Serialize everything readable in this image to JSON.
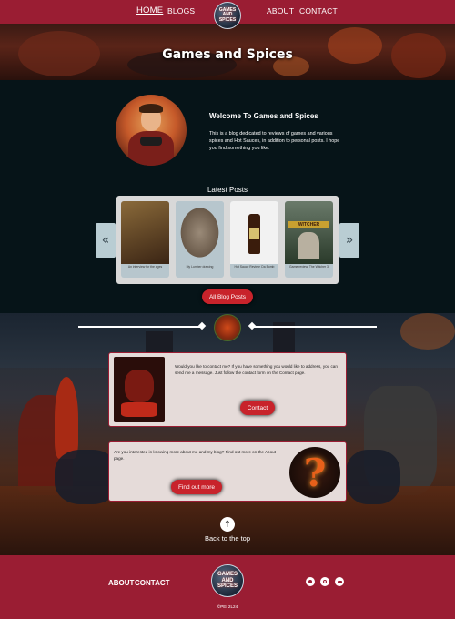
{
  "nav": {
    "home": "HOME",
    "blogs": "BLOGS",
    "about": "ABOUT",
    "contact": "CONTACT",
    "logo_text": "GAMES AND SPICES"
  },
  "hero": {
    "title": "Games and Spices"
  },
  "welcome": {
    "title": "Welcome To Games and Spices",
    "text": "This is a blog dedicated to reviews of games and various spices and Hot Sauces, in addition to personal posts. I hope you find something you like."
  },
  "latest": {
    "title": "Latest Posts",
    "prev_icon": "chevron-left-icon",
    "next_icon": "chevron-right-icon",
    "posts": [
      {
        "caption": "An interview for the ages",
        "color": "#6b4a2a"
      },
      {
        "caption": "My Lumber drawing",
        "color": "#8a7a6a"
      },
      {
        "caption": "Hot Sauce Review: Da Bomb",
        "color": "#f0f0f0"
      },
      {
        "caption": "Game review: The Witcher 3",
        "color": "#4a5a3a"
      }
    ],
    "button": "All Blog Posts"
  },
  "contact_box": {
    "text": "Would you like to contact me? If you have something you would like to address, you can send me a message. Just follow the contact form on the Contact page.",
    "button": "Contact"
  },
  "about_box": {
    "text": "Are you interested in knowing more about me and my blog? Find out more on the About page.",
    "button": "Find out more"
  },
  "back_to_top": "Back to the top",
  "footer": {
    "about": "ABOUT",
    "contact": "CONTACT",
    "logo_text": "GAMES AND SPICES",
    "social": [
      "facebook-icon",
      "instagram-icon",
      "youtube-icon"
    ],
    "copyright": "©PEI 2L24"
  },
  "colors": {
    "brand": "#9a1d33",
    "button": "#c8232b",
    "dark": "#061418"
  }
}
